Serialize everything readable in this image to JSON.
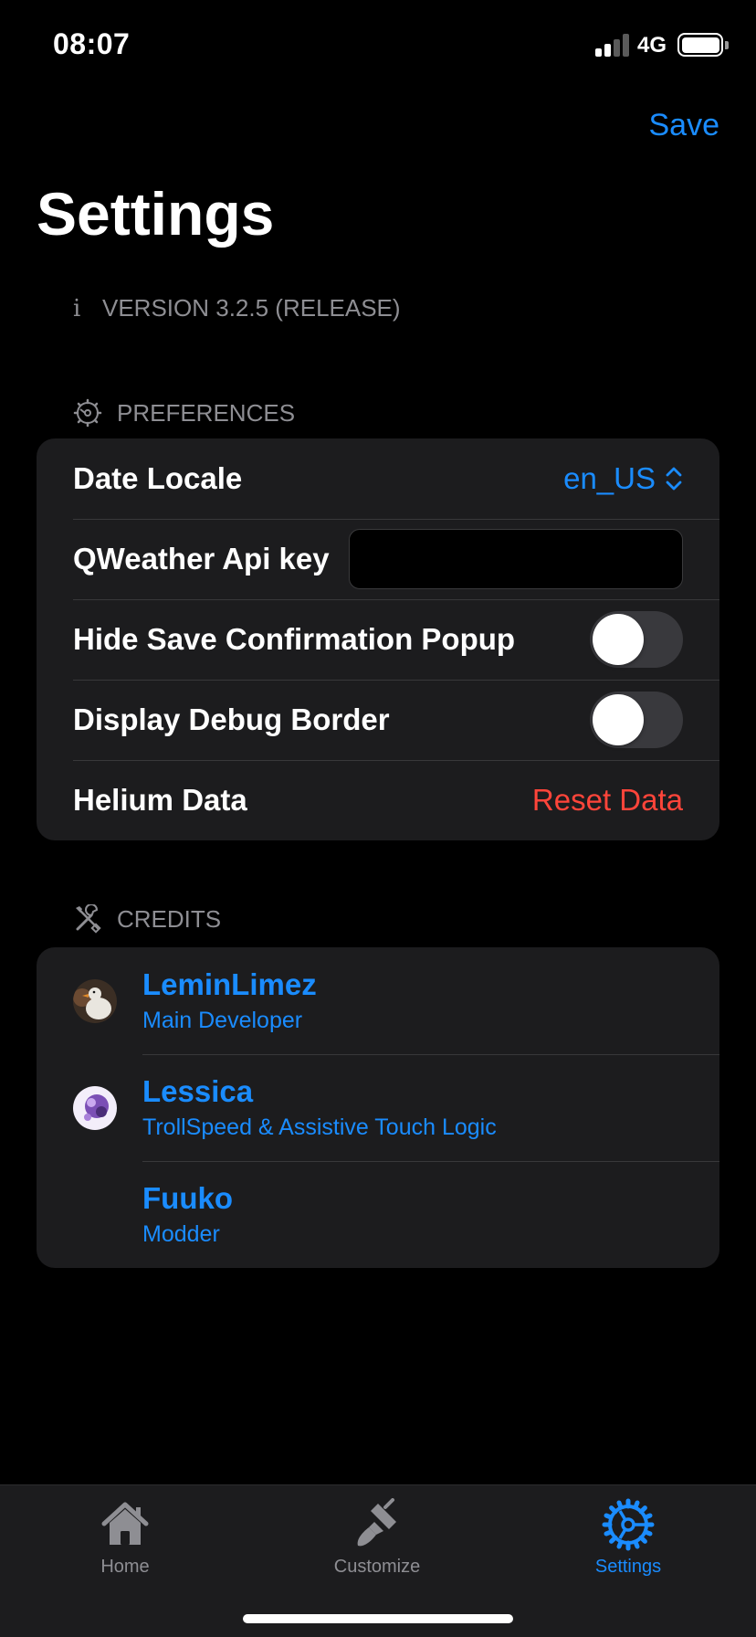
{
  "status_bar": {
    "time": "08:07",
    "network": "4G"
  },
  "nav": {
    "save_label": "Save",
    "title": "Settings"
  },
  "version": {
    "icon": "info-icon",
    "text": "VERSION 3.2.5 (RELEASE)"
  },
  "preferences": {
    "header": "PREFERENCES",
    "header_icon": "gear-icon",
    "rows": {
      "date_locale": {
        "label": "Date Locale",
        "value": "en_US"
      },
      "api_key": {
        "label": "QWeather Api key",
        "value": "",
        "placeholder": ""
      },
      "hide_popup": {
        "label": "Hide Save Confirmation Popup",
        "on": false
      },
      "debug_border": {
        "label": "Display Debug Border",
        "on": false
      },
      "helium_data": {
        "label": "Helium Data",
        "action": "Reset Data"
      }
    }
  },
  "credits": {
    "header": "CREDITS",
    "header_icon": "wrench-screwdriver-icon",
    "people": [
      {
        "name": "LeminLimez",
        "role": "Main Developer"
      },
      {
        "name": "Lessica",
        "role": "TrollSpeed & Assistive Touch Logic"
      },
      {
        "name": "Fuuko",
        "role": "Modder"
      }
    ]
  },
  "tabs": [
    {
      "label": "Home",
      "icon": "house-icon",
      "active": false
    },
    {
      "label": "Customize",
      "icon": "paintbrush-icon",
      "active": false
    },
    {
      "label": "Settings",
      "icon": "gear-icon",
      "active": true
    }
  ],
  "colors": {
    "accent": "#1a8cff",
    "destructive": "#ff453a",
    "inactive_tab": "#8e8e93",
    "cell_bg": "#1c1c1e"
  }
}
